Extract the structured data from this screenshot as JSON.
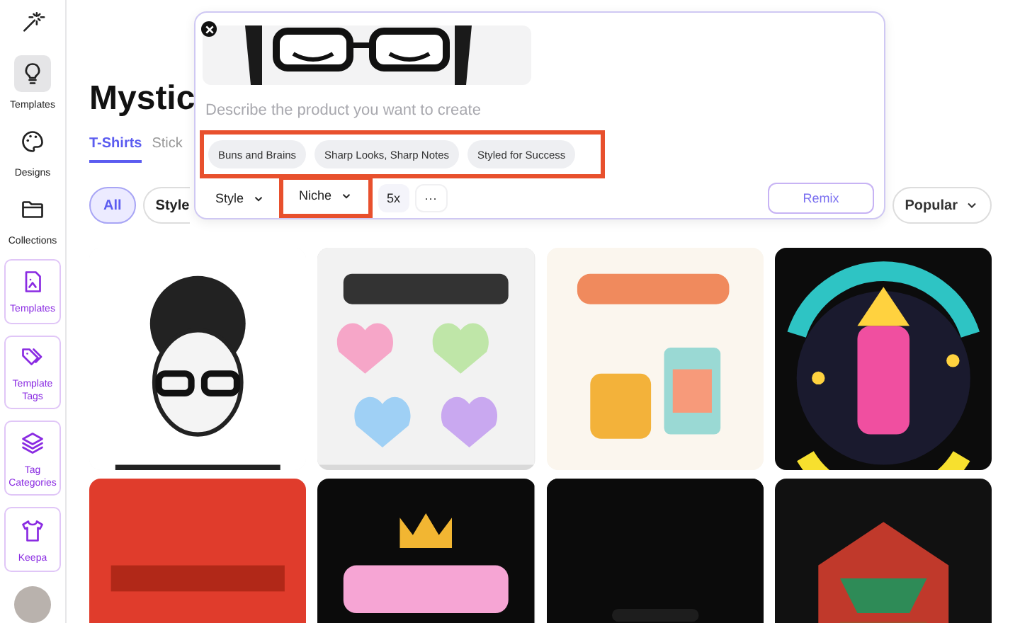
{
  "sidebar": {
    "items": [
      {
        "label": "Templates",
        "kind": "plain",
        "selected": true
      },
      {
        "label": "Designs",
        "kind": "plain",
        "selected": false
      },
      {
        "label": "Collections",
        "kind": "plain",
        "selected": false
      },
      {
        "label": "Templates",
        "kind": "admin",
        "selected": false
      },
      {
        "label": "Template Tags",
        "kind": "admin",
        "selected": false
      },
      {
        "label": "Tag Categories",
        "kind": "admin",
        "selected": false
      },
      {
        "label": "Keepa",
        "kind": "admin",
        "selected": false
      }
    ]
  },
  "page": {
    "title": "Mystic",
    "tabs": [
      {
        "label": "T-Shirts",
        "selected": true
      },
      {
        "label": "Stick",
        "selected": false
      }
    ],
    "filters": [
      {
        "label": "All",
        "selected": true
      },
      {
        "label": "Style",
        "selected": false
      }
    ],
    "sort": {
      "label": "Popular"
    }
  },
  "remix_panel": {
    "prompt": {
      "placeholder": "Describe the product you want to create"
    },
    "suggestions": [
      "Buns and Brains",
      "Sharp Looks, Sharp Notes",
      "Styled for Success"
    ],
    "controls": [
      {
        "label": "Style",
        "kind": "dropdown",
        "highlighted": false
      },
      {
        "label": "Niche",
        "kind": "dropdown",
        "highlighted": true
      },
      {
        "label": "5x",
        "kind": "count",
        "highlighted": false
      },
      {
        "label": "···",
        "kind": "more",
        "highlighted": false
      }
    ],
    "button": "Remix"
  }
}
